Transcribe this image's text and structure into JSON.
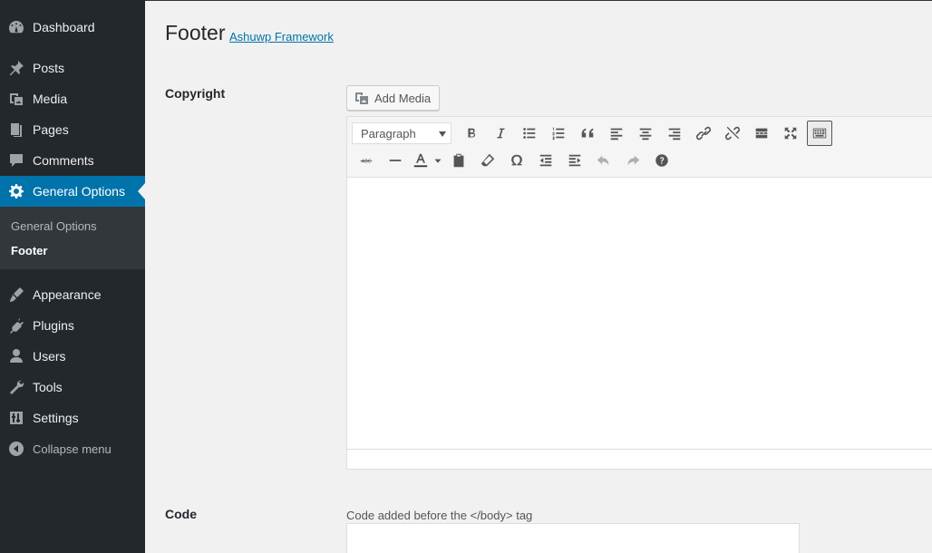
{
  "sidebar": {
    "dashboard": "Dashboard",
    "posts": "Posts",
    "media": "Media",
    "pages": "Pages",
    "comments": "Comments",
    "general_options": "General Options",
    "submenu": {
      "general_options": "General Options",
      "footer": "Footer"
    },
    "appearance": "Appearance",
    "plugins": "Plugins",
    "users": "Users",
    "tools": "Tools",
    "settings": "Settings",
    "collapse": "Collapse menu"
  },
  "header": {
    "title": "Footer",
    "framework_link": "Ashuwp Framework"
  },
  "fields": {
    "copyright": {
      "label": "Copyright",
      "add_media": "Add Media",
      "format_value": "Paragraph"
    },
    "code": {
      "label": "Code",
      "description": "Code added before the </body> tag"
    }
  },
  "colors": {
    "sidebar_bg": "#23282d",
    "active": "#0073aa",
    "link": "#0073aa"
  }
}
